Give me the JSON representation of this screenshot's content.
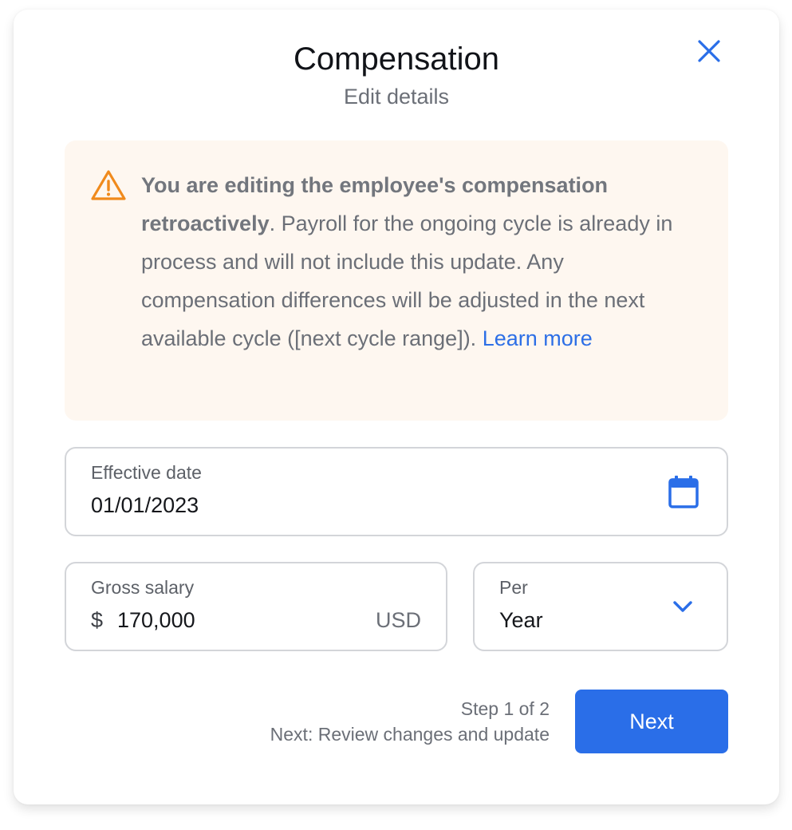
{
  "header": {
    "title": "Compensation",
    "subtitle": "Edit details",
    "close_icon": "close-icon"
  },
  "alert": {
    "icon": "warning-icon",
    "bold_text": "You are editing the employee's compensation retroactively",
    "text": ". Payroll for the ongoing cycle is already in process and will not include this update. Any compensation differences will be adjusted in the next available cycle ([next cycle range]). ",
    "link_text": "Learn more"
  },
  "effective_date": {
    "label": "Effective date",
    "value": "01/01/2023",
    "icon": "calendar-icon"
  },
  "gross_salary": {
    "label": "Gross salary",
    "currency_symbol": "$",
    "value": "170,000",
    "currency_code": "USD"
  },
  "per": {
    "label": "Per",
    "value": "Year",
    "icon": "chevron-down-icon"
  },
  "footer": {
    "step": "Step 1 of 2",
    "next_step": "Next: Review changes and update",
    "next_button": "Next"
  },
  "colors": {
    "accent": "#2a6ee8",
    "warning": "#f08a1c",
    "alert_bg": "#fef7f0"
  }
}
